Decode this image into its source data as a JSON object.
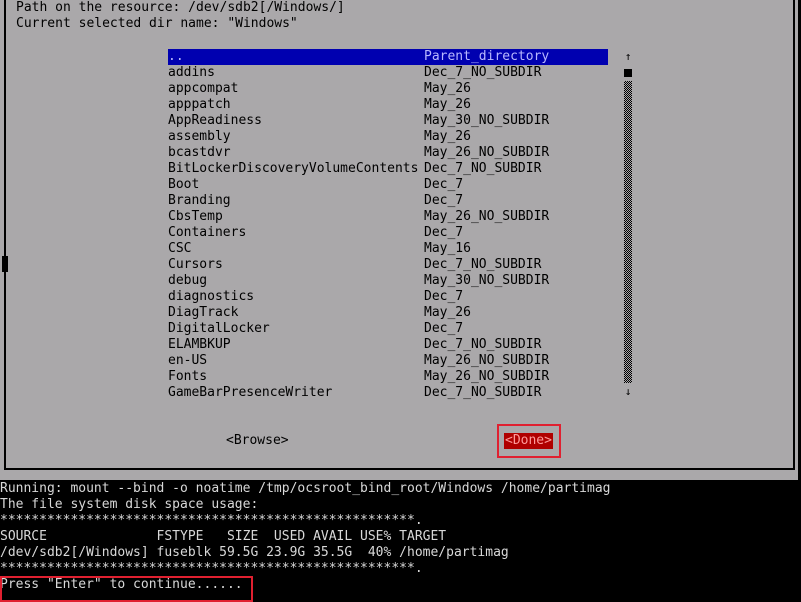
{
  "header": {
    "path_line": "Path on the resource: /dev/sdb2[/Windows/]",
    "current_dir_line": "Current selected dir name: \"Windows\""
  },
  "directory_list": {
    "selected_index": 0,
    "items": [
      {
        "name": "..",
        "info": "Parent_directory"
      },
      {
        "name": "addins",
        "info": "Dec_7_NO_SUBDIR"
      },
      {
        "name": "appcompat",
        "info": "May_26"
      },
      {
        "name": "apppatch",
        "info": "May_26"
      },
      {
        "name": "AppReadiness",
        "info": "May_30_NO_SUBDIR"
      },
      {
        "name": "assembly",
        "info": "May_26"
      },
      {
        "name": "bcastdvr",
        "info": "May_26_NO_SUBDIR"
      },
      {
        "name": "BitLockerDiscoveryVolumeContents",
        "info": "Dec_7_NO_SUBDIR"
      },
      {
        "name": "Boot",
        "info": "Dec_7"
      },
      {
        "name": "Branding",
        "info": "Dec_7"
      },
      {
        "name": "CbsTemp",
        "info": "May_26_NO_SUBDIR"
      },
      {
        "name": "Containers",
        "info": "Dec_7"
      },
      {
        "name": "CSC",
        "info": "May_16"
      },
      {
        "name": "Cursors",
        "info": "Dec_7_NO_SUBDIR"
      },
      {
        "name": "debug",
        "info": "May_30_NO_SUBDIR"
      },
      {
        "name": "diagnostics",
        "info": "Dec_7"
      },
      {
        "name": "DiagTrack",
        "info": "May_26"
      },
      {
        "name": "DigitalLocker",
        "info": "Dec_7"
      },
      {
        "name": "ELAMBKUP",
        "info": "Dec_7_NO_SUBDIR"
      },
      {
        "name": "en-US",
        "info": "May_26_NO_SUBDIR"
      },
      {
        "name": "Fonts",
        "info": "May_26_NO_SUBDIR"
      },
      {
        "name": "GameBarPresenceWriter",
        "info": "Dec_7_NO_SUBDIR"
      }
    ],
    "scroll_up_glyph": "↑",
    "scroll_down_glyph": "↓"
  },
  "buttons": {
    "browse_label": "<Browse>",
    "done_label": "<Done>"
  },
  "colors": {
    "dialog_bg": "#aaa8aa",
    "selection_bg": "#0000b0",
    "done_bg": "#b00000",
    "highlight_border": "#e02030"
  },
  "terminal": {
    "lines": [
      "Running: mount --bind -o noatime /tmp/ocsroot_bind_root/Windows /home/partimag",
      "The file system disk space usage:",
      "*****************************************************.",
      "SOURCE              FSTYPE   SIZE  USED AVAIL USE% TARGET",
      "/dev/sdb2[/Windows] fuseblk 59.5G 23.9G 35.5G  40% /home/partimag",
      "*****************************************************.",
      "Press \"Enter\" to continue......"
    ]
  }
}
